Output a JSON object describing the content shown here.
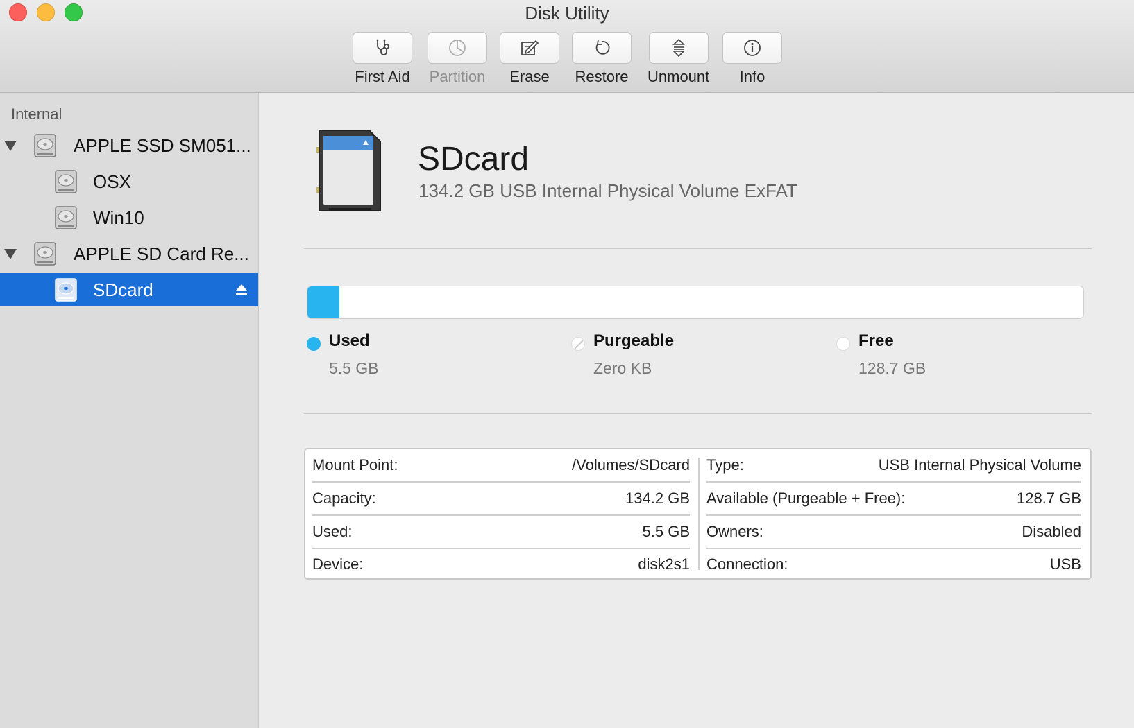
{
  "window": {
    "title": "Disk Utility"
  },
  "toolbar": {
    "items": [
      {
        "label": "First Aid",
        "icon": "stethoscope-icon",
        "enabled": true
      },
      {
        "label": "Partition",
        "icon": "partition-pie-icon",
        "enabled": false
      },
      {
        "label": "Erase",
        "icon": "erase-pencil-icon",
        "enabled": true
      },
      {
        "label": "Restore",
        "icon": "restore-arrow-icon",
        "enabled": true
      },
      {
        "label": "Unmount",
        "icon": "unmount-icon",
        "enabled": true
      },
      {
        "label": "Info",
        "icon": "info-icon",
        "enabled": true
      }
    ]
  },
  "sidebar": {
    "section": "Internal",
    "items": [
      {
        "label": "APPLE SSD SM051...",
        "level": 0,
        "expanded": true,
        "selected": false
      },
      {
        "label": "OSX",
        "level": 1,
        "selected": false
      },
      {
        "label": "Win10",
        "level": 1,
        "selected": false
      },
      {
        "label": "APPLE SD Card Re...",
        "level": 0,
        "expanded": true,
        "selected": false
      },
      {
        "label": "SDcard",
        "level": 1,
        "selected": true,
        "ejectable": true
      }
    ]
  },
  "volume": {
    "name": "SDcard",
    "description": "134.2 GB USB Internal Physical Volume ExFAT"
  },
  "usage": {
    "used_fraction": 0.041,
    "legend": [
      {
        "name": "Used",
        "value": "5.5 GB",
        "color": "#28b4ef"
      },
      {
        "name": "Purgeable",
        "value": "Zero KB",
        "color": "#ffffff"
      },
      {
        "name": "Free",
        "value": "128.7 GB",
        "color": "#ffffff"
      }
    ]
  },
  "details": {
    "left": [
      {
        "key": "Mount Point:",
        "value": "/Volumes/SDcard"
      },
      {
        "key": "Capacity:",
        "value": "134.2 GB"
      },
      {
        "key": "Used:",
        "value": "5.5 GB"
      },
      {
        "key": "Device:",
        "value": "disk2s1"
      }
    ],
    "right": [
      {
        "key": "Type:",
        "value": "USB Internal Physical Volume"
      },
      {
        "key": "Available (Purgeable + Free):",
        "value": "128.7 GB"
      },
      {
        "key": "Owners:",
        "value": "Disabled"
      },
      {
        "key": "Connection:",
        "value": "USB"
      }
    ]
  },
  "colors": {
    "selection": "#1a6ed8",
    "used": "#28b4ef"
  }
}
